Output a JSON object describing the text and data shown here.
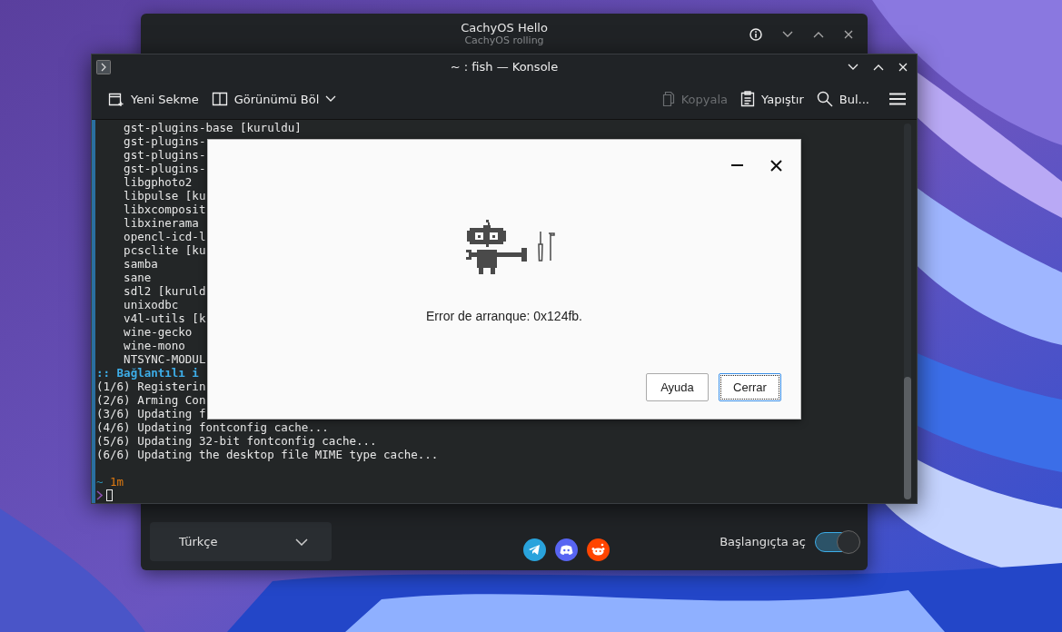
{
  "hello_window": {
    "title": "CachyOS Hello",
    "subtitle": "CachyOS rolling",
    "language_select": {
      "value": "Türkçe"
    },
    "social_links": [
      {
        "kind": "telegram"
      },
      {
        "kind": "discord"
      },
      {
        "kind": "reddit"
      }
    ],
    "autostart": {
      "label": "Başlangıçta aç",
      "on": true
    }
  },
  "konsole": {
    "title": "~ : fish — Konsole",
    "toolbar": [
      {
        "label": "Yeni Sekme",
        "kind": "new-tab",
        "disabled": false
      },
      {
        "label": "Görünümü Böl",
        "kind": "split",
        "disabled": false
      },
      {
        "label": "Kopyala",
        "kind": "copy",
        "disabled": true
      },
      {
        "label": "Yapıştır",
        "kind": "paste",
        "disabled": false
      },
      {
        "label": "Bul...",
        "kind": "find",
        "disabled": false
      }
    ],
    "lines": [
      {
        "text": "    gst-plugins-base [kuruldu]",
        "kind": "plain"
      },
      {
        "text": "    gst-plugins-",
        "kind": "plain"
      },
      {
        "text": "    gst-plugins-",
        "kind": "plain"
      },
      {
        "text": "    gst-plugins-",
        "kind": "plain"
      },
      {
        "text": "    libgphoto2",
        "kind": "plain"
      },
      {
        "text": "    libpulse [ku",
        "kind": "plain"
      },
      {
        "text": "    libxcomposit",
        "kind": "plain"
      },
      {
        "text": "    libxinerama",
        "kind": "plain"
      },
      {
        "text": "    opencl-icd-l",
        "kind": "plain"
      },
      {
        "text": "    pcsclite [ku",
        "kind": "plain"
      },
      {
        "text": "    samba",
        "kind": "plain"
      },
      {
        "text": "    sane",
        "kind": "plain"
      },
      {
        "text": "    sdl2 [kuruld",
        "kind": "plain"
      },
      {
        "text": "    unixodbc",
        "kind": "plain"
      },
      {
        "text": "    v4l-utils [k",
        "kind": "plain"
      },
      {
        "text": "    wine-gecko",
        "kind": "plain"
      },
      {
        "text": "    wine-mono",
        "kind": "plain"
      },
      {
        "text": "    NTSYNC-MODUL",
        "kind": "plain"
      },
      {
        "text": ":: Bağlantılı i",
        "kind": "heading"
      },
      {
        "text": "(1/6) Registerin",
        "kind": "plain"
      },
      {
        "text": "(2/6) Arming Con",
        "kind": "plain"
      },
      {
        "text": "(3/6) Updating f",
        "kind": "plain"
      },
      {
        "text": "(4/6) Updating fontconfig cache...",
        "kind": "plain"
      },
      {
        "text": "(5/6) Updating 32-bit fontconfig cache...",
        "kind": "plain"
      },
      {
        "text": "(6/6) Updating the desktop file MIME type cache...",
        "kind": "plain"
      }
    ],
    "prompt": {
      "path": "~",
      "duration": "1m"
    }
  },
  "dialog": {
    "message": "Error de arranque: 0x124fb.",
    "buttons": [
      {
        "label": "Ayuda",
        "default": false
      },
      {
        "label": "Cerrar",
        "default": true
      }
    ]
  }
}
